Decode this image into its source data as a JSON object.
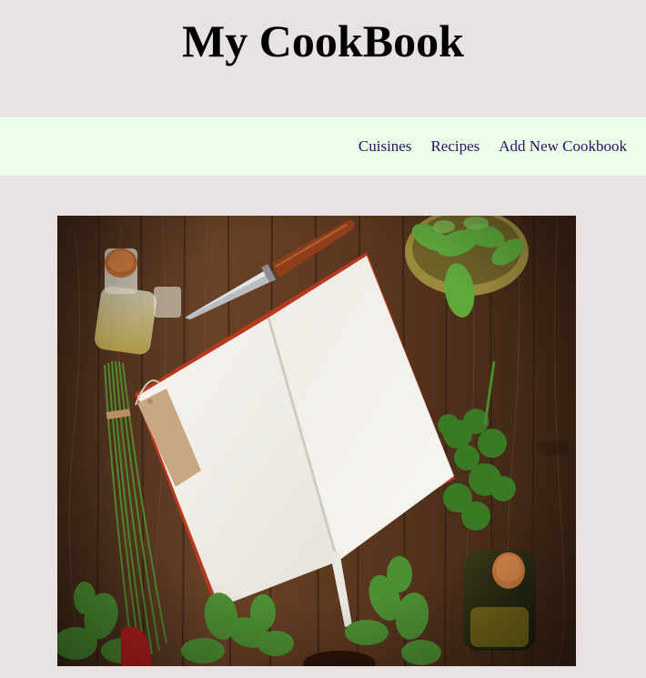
{
  "site": {
    "title": "My CookBook"
  },
  "nav": {
    "items": [
      {
        "label": "Cuisines"
      },
      {
        "label": "Recipes"
      },
      {
        "label": "Add New Cookbook"
      }
    ]
  },
  "colors": {
    "page_background": "#e8e2e2",
    "navbar_background": "#ebffe8",
    "nav_link": "#2b1266",
    "title": "#000000"
  },
  "hero": {
    "subject": "open blank notebook on wooden table surrounded by herbs, oil bottles and a knife"
  }
}
